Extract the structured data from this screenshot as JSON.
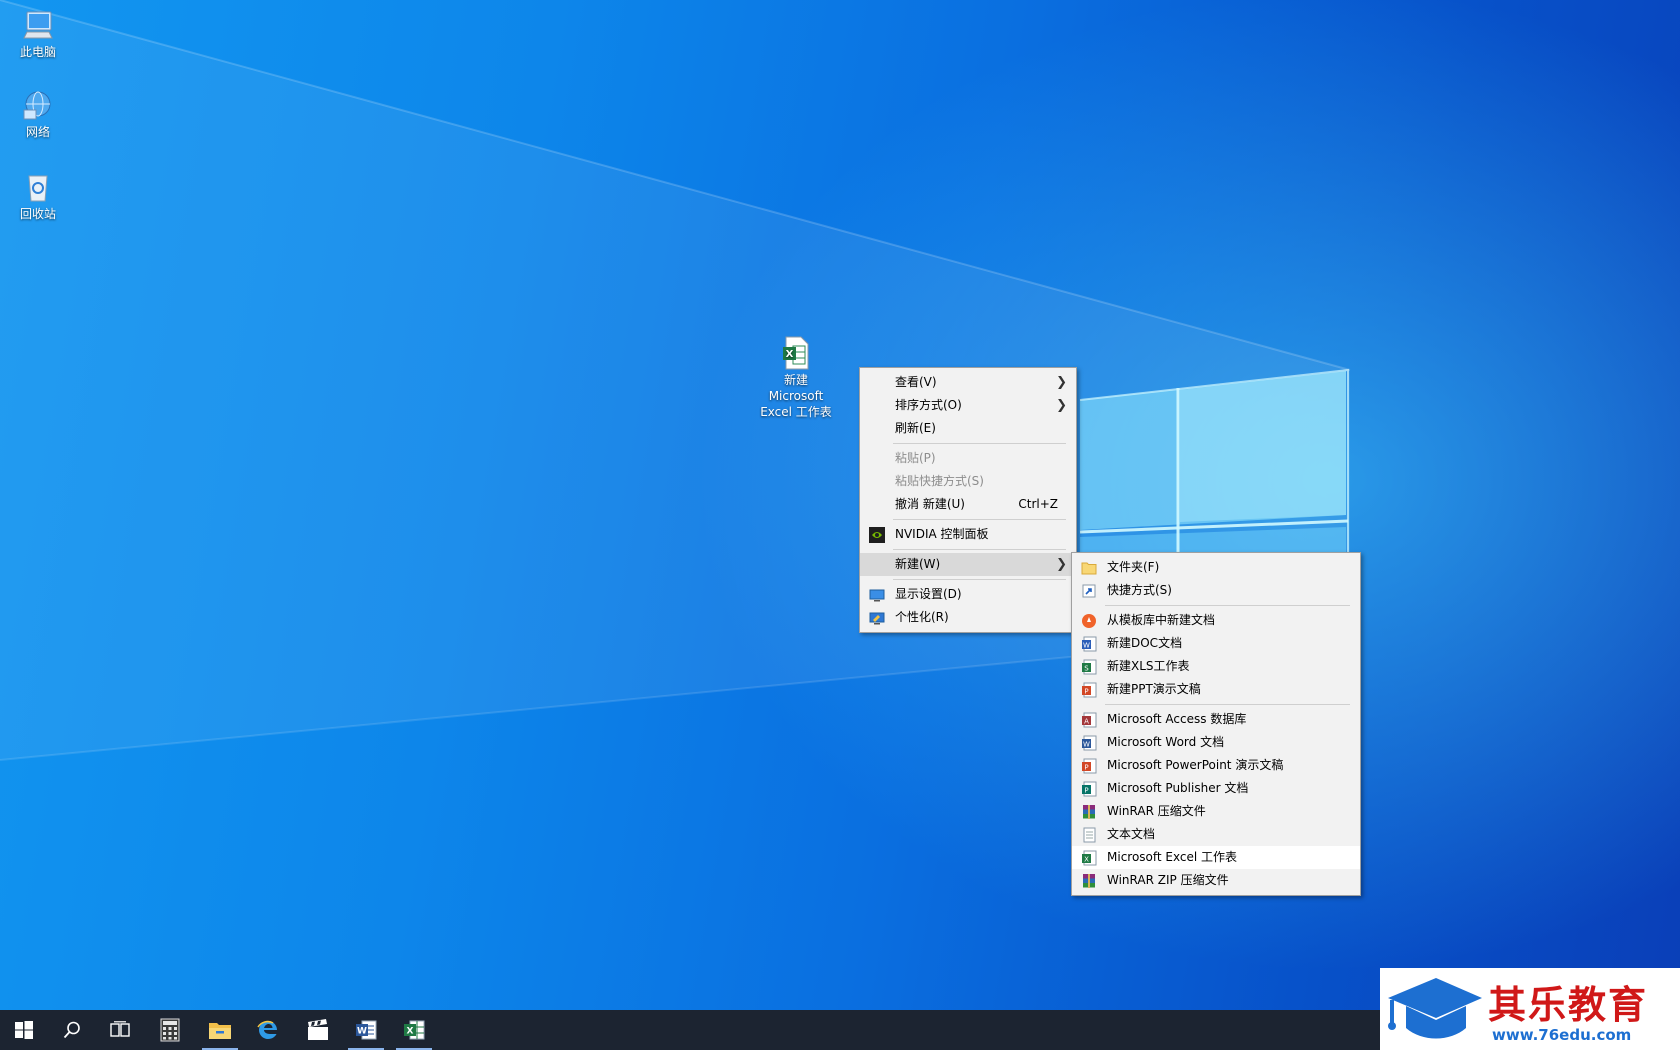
{
  "desktop_icons": [
    {
      "label": "此电脑",
      "icon": "computer-icon"
    },
    {
      "label": "网络",
      "icon": "network-icon"
    },
    {
      "label": "回收站",
      "icon": "recycle-bin-icon"
    }
  ],
  "new_file_icon": {
    "label": "新建 Microsoft Excel 工作表",
    "icon": "excel-file-icon"
  },
  "context_menu": {
    "view": "查看(V)",
    "sort": "排序方式(O)",
    "refresh": "刷新(E)",
    "paste": "粘贴(P)",
    "paste_shortcut": "粘贴快捷方式(S)",
    "undo": "撤消 新建(U)",
    "undo_shortcut": "Ctrl+Z",
    "nvidia": "NVIDIA 控制面板",
    "new": "新建(W)",
    "display": "显示设置(D)",
    "personalize": "个性化(R)"
  },
  "new_submenu": {
    "folder": "文件夹(F)",
    "shortcut": "快捷方式(S)",
    "template": "从模板库中新建文档",
    "doc": "新建DOC文档",
    "xls": "新建XLS工作表",
    "ppt": "新建PPT演示文稿",
    "access": "Microsoft Access 数据库",
    "word": "Microsoft Word 文档",
    "powerpoint": "Microsoft PowerPoint 演示文稿",
    "publisher": "Microsoft Publisher 文档",
    "winrar": "WinRAR 压缩文件",
    "text": "文本文档",
    "excel": "Microsoft Excel 工作表",
    "winrar_zip": "WinRAR ZIP 压缩文件"
  },
  "taskbar": {
    "items": [
      "start-icon",
      "search-icon",
      "task-view-icon",
      "calculator-icon",
      "file-explorer-icon",
      "edge-icon",
      "movies-icon",
      "word-icon",
      "excel-icon"
    ]
  },
  "watermark": {
    "title": "其乐教育",
    "url": "www.76edu.com"
  },
  "colors": {
    "accent": "#0a6fe0",
    "taskbar": "#1c2431",
    "menu_bg": "#f2f2f2",
    "watermark_red": "#d01818",
    "watermark_blue": "#1d6fd1"
  }
}
